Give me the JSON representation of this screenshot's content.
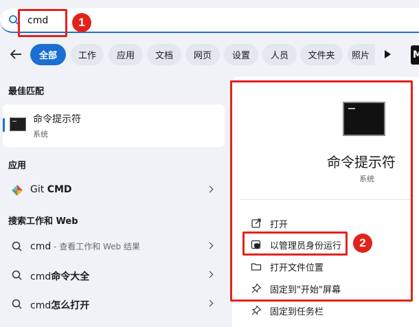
{
  "search": {
    "value": "cmd"
  },
  "badges": {
    "one": "1",
    "two": "2"
  },
  "filters": {
    "items": [
      "全部",
      "工作",
      "应用",
      "文档",
      "网页",
      "设置",
      "人员",
      "文件夹",
      "照片"
    ],
    "more_tile": "M"
  },
  "best_match": {
    "heading": "最佳匹配",
    "title": "命令提示符",
    "subtitle": "系统"
  },
  "apps": {
    "heading": "应用",
    "items": [
      {
        "prefix": "Git ",
        "bold": "CMD"
      }
    ]
  },
  "web": {
    "heading": "搜索工作和 Web",
    "items": [
      {
        "prefix": "cmd",
        "bold": "",
        "sub": " - 查看工作和 Web 结果"
      },
      {
        "prefix": "cmd",
        "bold": "命令大全",
        "sub": ""
      },
      {
        "prefix": "cmd",
        "bold": "怎么打开",
        "sub": ""
      }
    ]
  },
  "detail": {
    "app_name": "命令提示符",
    "app_kind": "系统",
    "actions": [
      "打开",
      "以管理员身份运行",
      "打开文件位置",
      "固定到\"开始\"屏幕",
      "固定到任务栏"
    ]
  },
  "colors": {
    "accent": "#1a6fd1",
    "highlight": "#e2231a"
  }
}
